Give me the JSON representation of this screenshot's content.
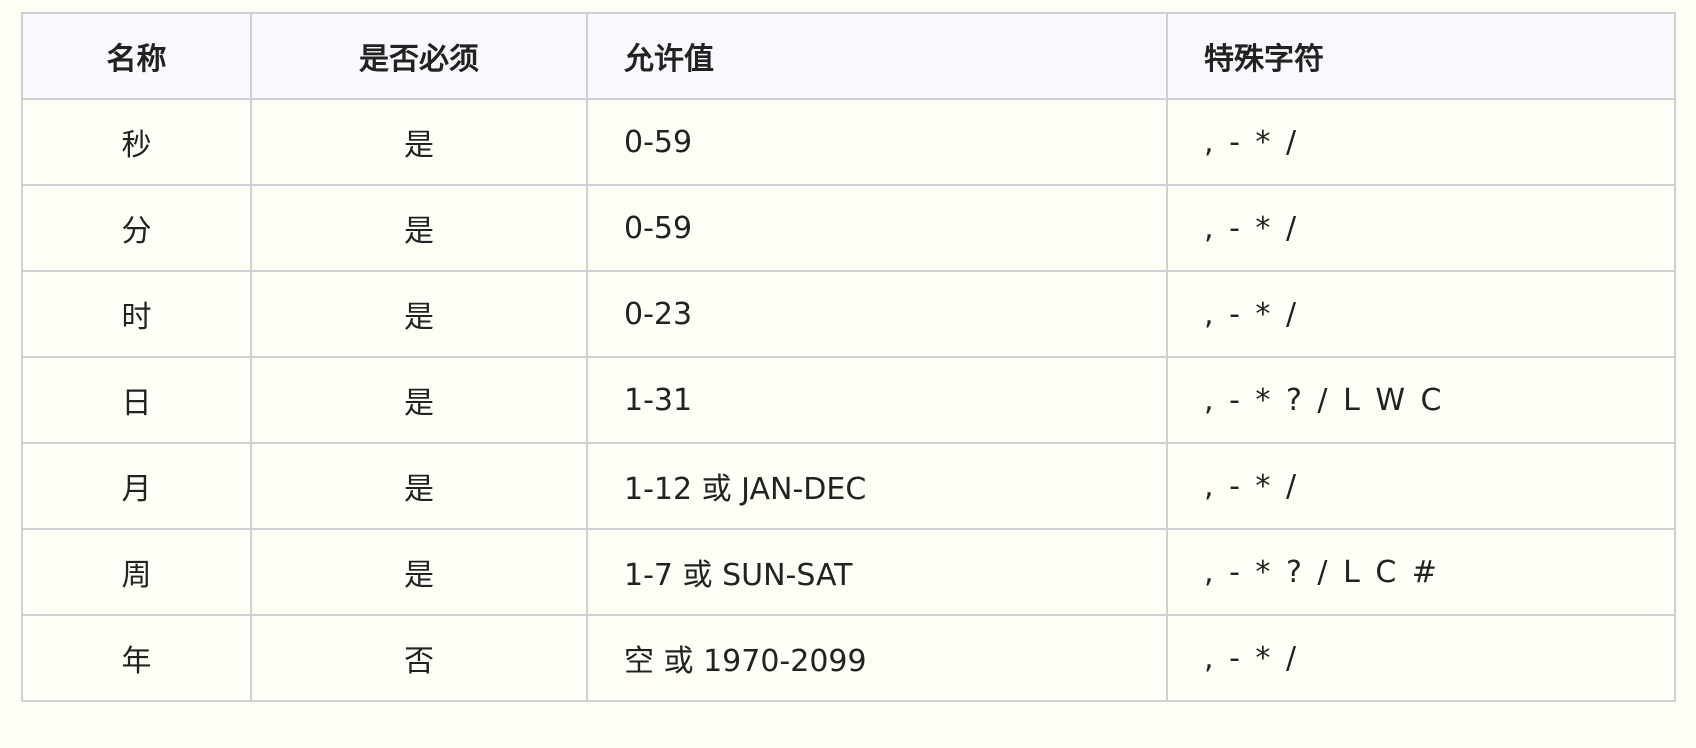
{
  "table": {
    "headers": {
      "name": "名称",
      "required": "是否必须",
      "allowed": "允许值",
      "special": "特殊字符"
    },
    "rows": [
      {
        "name": "秒",
        "required": "是",
        "allowed": "0-59",
        "special": ", - * /"
      },
      {
        "name": "分",
        "required": "是",
        "allowed": "0-59",
        "special": ", - * /"
      },
      {
        "name": "时",
        "required": "是",
        "allowed": "0-23",
        "special": ", - * /"
      },
      {
        "name": "日",
        "required": "是",
        "allowed": "1-31",
        "special": ", - * ? / L W C"
      },
      {
        "name": "月",
        "required": "是",
        "allowed": "1-12 或 JAN-DEC",
        "special": ", - * /"
      },
      {
        "name": "周",
        "required": "是",
        "allowed": "1-7 或 SUN-SAT",
        "special": ", - * ? / L C #"
      },
      {
        "name": "年",
        "required": "否",
        "allowed": "空 或 1970-2099",
        "special": ", - * /"
      }
    ]
  },
  "colors": {
    "header_bg": "#f8f9fc",
    "row_bg": "#fefdf6",
    "border": "#cfcfd4",
    "text": "#222222"
  }
}
